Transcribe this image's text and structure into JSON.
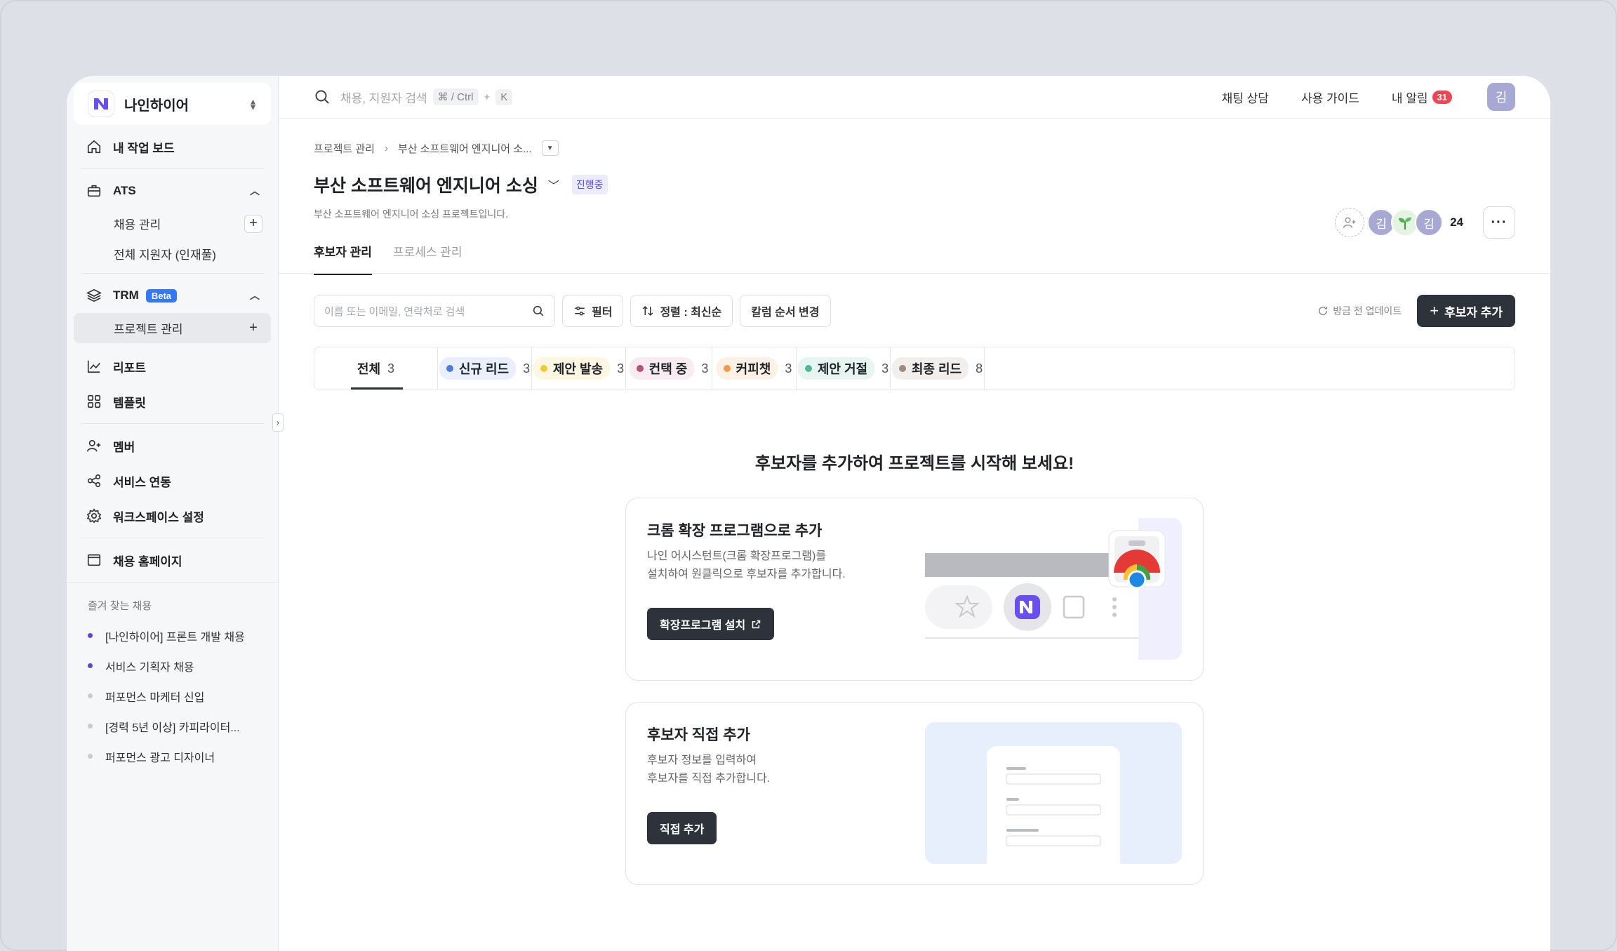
{
  "workspace": {
    "name": "나인하이어"
  },
  "sidebar": {
    "my_board": "내 작업 보드",
    "ats": {
      "label": "ATS",
      "items": [
        "채용 관리",
        "전체 지원자 (인재풀)"
      ]
    },
    "trm": {
      "label": "TRM",
      "beta": "Beta",
      "items": [
        "프로젝트 관리"
      ]
    },
    "report": "리포트",
    "template": "템플릿",
    "member": "멤버",
    "integration": "서비스 연동",
    "settings": "워크스페이스 설정",
    "homepage": "채용 홈페이지",
    "favorites_title": "즐겨 찾는 채용",
    "favorites": [
      {
        "label": "[나인하이어] 프론트 개발 채용",
        "color": "#5b45e0"
      },
      {
        "label": "서비스 기획자 채용",
        "color": "#5b45e0"
      },
      {
        "label": "퍼포먼스 마케터 신입",
        "color": "#c9ccd2"
      },
      {
        "label": "[경력 5년 이상] 카피라이터...",
        "color": "#c9ccd2"
      },
      {
        "label": "퍼포먼스 광고 디자이너",
        "color": "#c9ccd2"
      }
    ]
  },
  "topbar": {
    "search_placeholder": "채용, 지원자 검색",
    "shortcut_1": "⌘ / Ctrl",
    "shortcut_plus": "+",
    "shortcut_2": "K",
    "chat": "채팅 상담",
    "guide": "사용 가이드",
    "notifications": "내 알림",
    "notification_count": "31",
    "user_initial": "김"
  },
  "project": {
    "breadcrumb_root": "프로젝트 관리",
    "breadcrumb_current": "부산 소프트웨어 엔지니어 소...",
    "title": "부산 소프트웨어 엔지니어 소싱",
    "status": "진행중",
    "description": "부산 소프트웨어 엔지니어 소싱 프로젝트입니다.",
    "tabs": [
      "후보자 관리",
      "프로세스 관리"
    ],
    "member_initials": [
      "김",
      "김"
    ],
    "member_count": "24"
  },
  "toolbar": {
    "search_placeholder": "이름 또는 이메일, 연락처로 검색",
    "filter": "필터",
    "sort": "정렬 : 최신순",
    "column_order": "칼럼 순서 변경",
    "updated": "방금 전 업데이트",
    "add_candidate": "후보자 추가"
  },
  "stages": [
    {
      "label": "전체",
      "count": "3"
    },
    {
      "label": "신규 리드",
      "count": "3",
      "color": "#4d7bd8",
      "bg": "#eaf0fb"
    },
    {
      "label": "제안 발송",
      "count": "3",
      "color": "#f0c93b",
      "bg": "#fdf7e2"
    },
    {
      "label": "컨택 중",
      "count": "3",
      "color": "#b5517a",
      "bg": "#f8ecf1"
    },
    {
      "label": "커피챗",
      "count": "3",
      "color": "#f29a4a",
      "bg": "#fdf0e4"
    },
    {
      "label": "제안 거절",
      "count": "3",
      "color": "#4fb59b",
      "bg": "#e7f5f1"
    },
    {
      "label": "최종 리드",
      "count": "8",
      "color": "#9c8c80",
      "bg": "#f1eeeb"
    }
  ],
  "empty": {
    "title": "후보자를 추가하여 프로젝트를 시작해 보세요!",
    "card1": {
      "title": "크롬 확장 프로그램으로 추가",
      "line1": "나인 어시스턴트(크롬 확장프로그램)를",
      "line2": "설치하여 원클릭으로 후보자를 추가합니다.",
      "button": "확장프로그램 설치"
    },
    "card2": {
      "title": "후보자 직접 추가",
      "line1": "후보자 정보를 입력하여",
      "line2": "후보자를 직접 추가합니다.",
      "button": "직접 추가"
    }
  }
}
